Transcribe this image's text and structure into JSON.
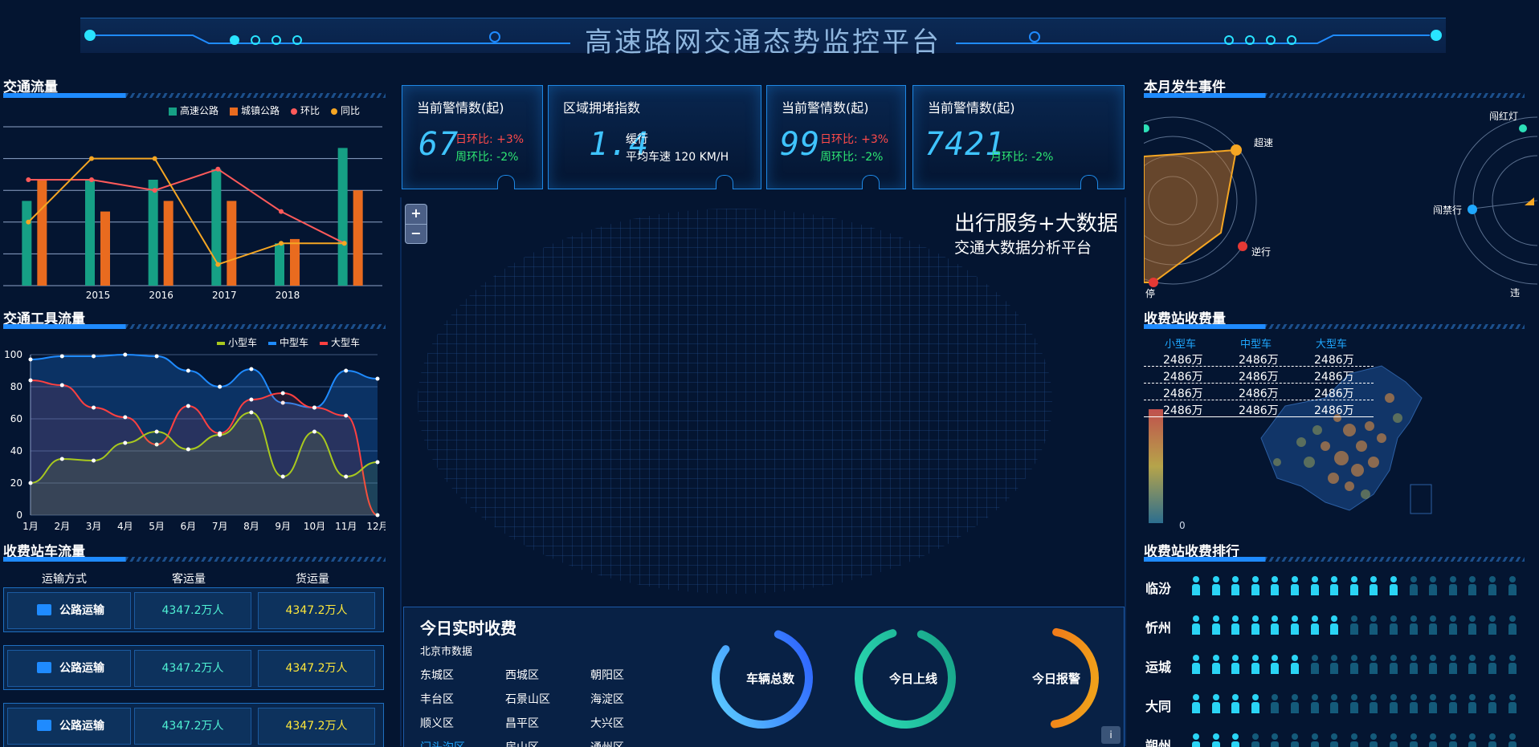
{
  "header": {
    "title": "高速路网交通态势监控平台"
  },
  "traffic_flow": {
    "title": "交通流量",
    "legend": [
      "高速公路",
      "城镇公路",
      "环比",
      "同比"
    ],
    "colors": {
      "highway": "#16a085",
      "town": "#e96b1f",
      "mom": "#ff5a5a",
      "yoy": "#f5a623"
    },
    "chart_data": {
      "type": "bar",
      "categories": [
        "",
        "2015",
        "2016",
        "2017",
        "2018",
        ""
      ],
      "series": [
        {
          "name": "高速公路",
          "values": [
            40,
            50,
            50,
            55,
            20,
            65
          ]
        },
        {
          "name": "城镇公路",
          "values": [
            50,
            35,
            40,
            40,
            22,
            45
          ]
        },
        {
          "name": "环比",
          "values": [
            50,
            50,
            45,
            55,
            35,
            20
          ]
        },
        {
          "name": "同比",
          "values": [
            30,
            60,
            60,
            10,
            20,
            20
          ]
        }
      ],
      "ylim": [
        0,
        75
      ]
    }
  },
  "vehicle_flow": {
    "title": "交通工具流量",
    "legend": [
      "小型车",
      "中型车",
      "大型车"
    ],
    "colors": {
      "small": "#a8c81e",
      "medium": "#1f8bff",
      "large": "#ff4040"
    },
    "chart_data": {
      "type": "line",
      "categories": [
        "1月",
        "2月",
        "3月",
        "4月",
        "5月",
        "6月",
        "7月",
        "8月",
        "9月",
        "10月",
        "11月",
        "12月"
      ],
      "yticks": [
        "100",
        "80",
        "60",
        "40",
        "20",
        "0"
      ],
      "ylim": [
        0,
        100
      ],
      "series": [
        {
          "name": "小型车",
          "values": [
            20,
            35,
            34,
            45,
            52,
            41,
            50,
            64,
            24,
            52,
            24,
            33
          ]
        },
        {
          "name": "中型车",
          "values": [
            97,
            99,
            99,
            100,
            99,
            90,
            80,
            91,
            70,
            67,
            90,
            85
          ]
        },
        {
          "name": "大型车",
          "values": [
            84,
            81,
            67,
            61,
            44,
            68,
            51,
            72,
            76,
            67,
            62,
            0
          ]
        }
      ]
    }
  },
  "station_flow": {
    "title": "收费站车流量",
    "headers": [
      "运输方式",
      "客运量",
      "货运量"
    ],
    "rows": [
      {
        "mode": "公路运输",
        "passenger": "4347.2万人",
        "freight": "4347.2万人"
      },
      {
        "mode": "公路运输",
        "passenger": "4347.2万人",
        "freight": "4347.2万人"
      },
      {
        "mode": "公路运输",
        "passenger": "4347.2万人",
        "freight": "4347.2万人"
      }
    ]
  },
  "kpis": [
    {
      "title": "当前警情数(起)",
      "value": "67",
      "line1": "日环比: +3%",
      "line2": "周环比: -2%"
    },
    {
      "title": "区域拥堵指数",
      "value": "1.4",
      "line1": "缓行",
      "line2": "平均车速 120  KM/H"
    },
    {
      "title": "当前警情数(起)",
      "value": "99",
      "line1": "日环比: +3%",
      "line2": "周环比: -2%"
    },
    {
      "title": "当前警情数(起)",
      "value": "7421",
      "line1": "",
      "line2": "月环比: -2%"
    }
  ],
  "map": {
    "zoom_in": "+",
    "zoom_out": "−"
  },
  "brand": {
    "line1": "出行服务+大数据",
    "line2": "交通大数据分析平台"
  },
  "realtime": {
    "title": "今日实时收费",
    "subtitle": "北京市数据",
    "districts": [
      "东城区",
      "西城区",
      "朝阳区",
      "丰台区",
      "石景山区",
      "海淀区",
      "顺义区",
      "昌平区",
      "大兴区",
      "门头沟区",
      "房山区",
      "通州区"
    ],
    "rings": [
      {
        "label": "车辆总数",
        "level": 0.8
      },
      {
        "label": "今日上线",
        "level": 0.9
      },
      {
        "label": "今日报警",
        "level": 0.45
      }
    ],
    "info": "i"
  },
  "events": {
    "title": "本月发生事件",
    "radar_labels": [
      "超速",
      "逆行"
    ],
    "radar_labels_partial": [
      "停"
    ],
    "radar2_labels": [
      "闯红灯",
      "闯禁行"
    ],
    "radar2_labels_partial": [
      "违"
    ]
  },
  "station_fee": {
    "title": "收费站收费量",
    "headers": [
      "小型车",
      "中型车",
      "大型车"
    ],
    "rows": [
      [
        "2486万",
        "2486万",
        "2486万"
      ],
      [
        "2486万",
        "2486万",
        "2486万"
      ],
      [
        "2486万",
        "2486万",
        "2486万"
      ],
      [
        "2486万",
        "2486万",
        "2486万"
      ]
    ],
    "scale_min": "0"
  },
  "ranking": {
    "title": "收费站收费排行",
    "items": [
      {
        "name": "临汾",
        "level": 0.65
      },
      {
        "name": "忻州",
        "level": 0.45
      },
      {
        "name": "运城",
        "level": 0.35
      },
      {
        "name": "大同",
        "level": 0.25
      },
      {
        "name": "朔州",
        "level": 0.2
      }
    ],
    "icon_count": 17
  }
}
